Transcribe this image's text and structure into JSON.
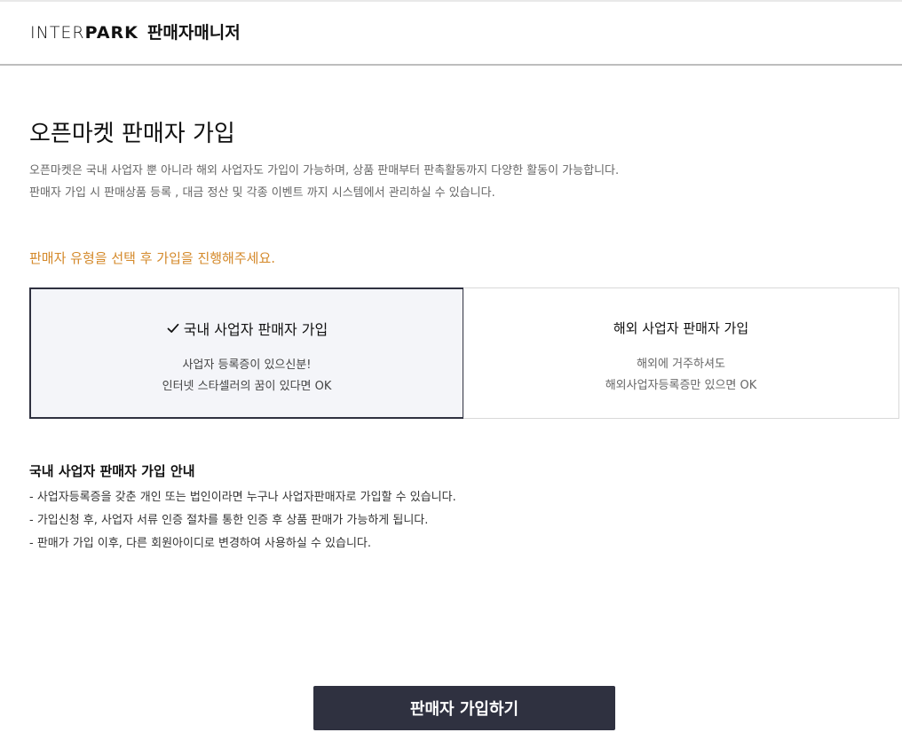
{
  "header": {
    "logo_light": "INTER",
    "logo_bold": "PARK",
    "logo_kr": "판매자매니저"
  },
  "main": {
    "title": "오픈마켓 판매자 가입",
    "description": [
      "오픈마켓은 국내 사업자 뿐 아니라 해외 사업자도 가입이 가능하며, 상품 판매부터 판촉활동까지 다양한 활동이 가능합니다.",
      "판매자 가입 시 판매상품 등록 , 대금 정산 및 각종 이벤트 까지 시스템에서 관리하실 수 있습니다."
    ],
    "guide": "판매자 유형을 선택 후 가입을 진행해주세요.",
    "accent_color": "#d4892a"
  },
  "seller_types": [
    {
      "title": "국내 사업자 판매자 가입",
      "selected": true,
      "lines": [
        "사업자 등록증이 있으신분!",
        "인터넷 스타셀러의 꿈이 있다면 OK"
      ]
    },
    {
      "title": "해외 사업자 판매자 가입",
      "selected": false,
      "lines": [
        "해외에 거주하셔도",
        "해외사업자등록증만 있으면 OK"
      ]
    }
  ],
  "info": {
    "title": "국내 사업자 판매자 가입 안내",
    "items": [
      "- 사업자등록증을 갖춘 개인 또는 법인이라면 누구나 사업자판매자로 가입할 수 있습니다.",
      "- 가입신청 후, 사업자 서류 인증 절차를 통한 인증 후 상품 판매가 가능하게 됩니다.",
      "- 판매가 가입 이후, 다른 회원아이디로 변경하여 사용하실 수 있습니다."
    ]
  },
  "submit_label": "판매자 가입하기",
  "theme": {
    "dark": "#2f3140",
    "selected_bg": "#f4f5f9"
  }
}
